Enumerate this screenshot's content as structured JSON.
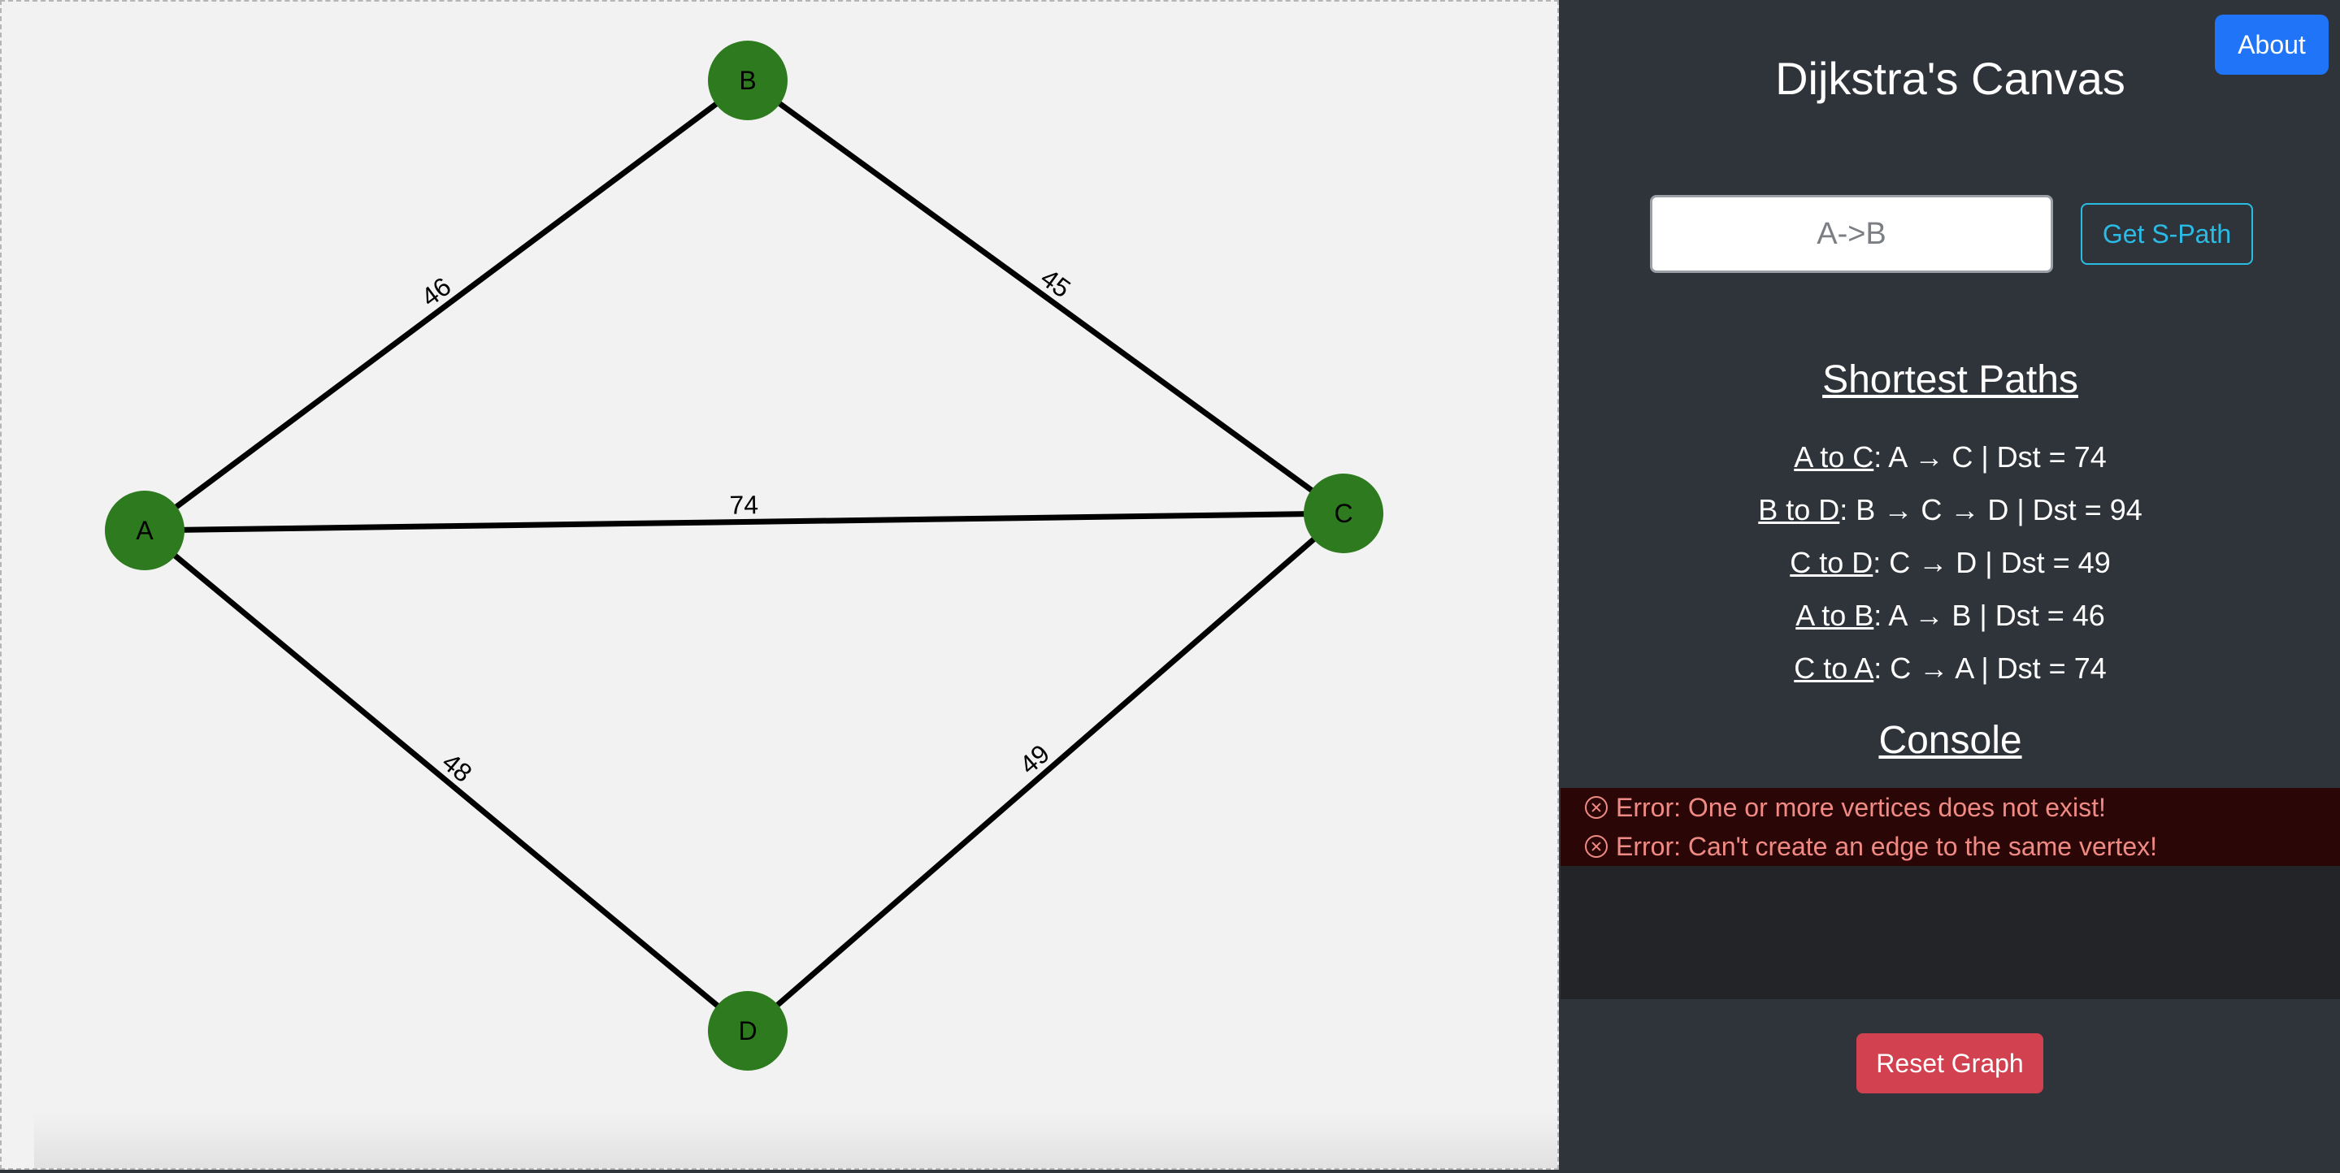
{
  "header": {
    "title": "Dijkstra's Canvas",
    "about_label": "About"
  },
  "search": {
    "placeholder": "A->B",
    "button_label": "Get S-Path"
  },
  "graph": {
    "vertices": [
      {
        "id": "A",
        "label": "A"
      },
      {
        "id": "B",
        "label": "B"
      },
      {
        "id": "C",
        "label": "C"
      },
      {
        "id": "D",
        "label": "D"
      }
    ],
    "edges": [
      {
        "from": "A",
        "to": "B",
        "weight": "46"
      },
      {
        "from": "B",
        "to": "C",
        "weight": "45"
      },
      {
        "from": "A",
        "to": "C",
        "weight": "74"
      },
      {
        "from": "A",
        "to": "D",
        "weight": "48"
      },
      {
        "from": "D",
        "to": "C",
        "weight": "49"
      }
    ],
    "colors": {
      "vertex": "#2d7a1f",
      "edge": "#000000"
    }
  },
  "shortest_paths": {
    "heading": "Shortest Paths",
    "items": [
      {
        "name": "A to C",
        "detail": ": A → C | Dst = 74"
      },
      {
        "name": "B to D",
        "detail": ": B → C → D | Dst = 94"
      },
      {
        "name": "C to D",
        "detail": ": C → D | Dst = 49"
      },
      {
        "name": "A to B",
        "detail": ": A → B | Dst = 46"
      },
      {
        "name": "C to A",
        "detail": ": C → A | Dst = 74"
      }
    ]
  },
  "console": {
    "heading": "Console",
    "errors": [
      "Error: One or more vertices does not exist!",
      "Error: Can't create an edge to the same vertex!"
    ]
  },
  "footer": {
    "reset_label": "Reset Graph"
  },
  "colors": {
    "sidebar_bg": "#2f343b",
    "canvas_bg": "#f2f2f2",
    "about_button": "#1f74f7",
    "get_path_button": "#2bbce6",
    "reset_button": "#d2414f",
    "error_text": "#f08a84"
  }
}
